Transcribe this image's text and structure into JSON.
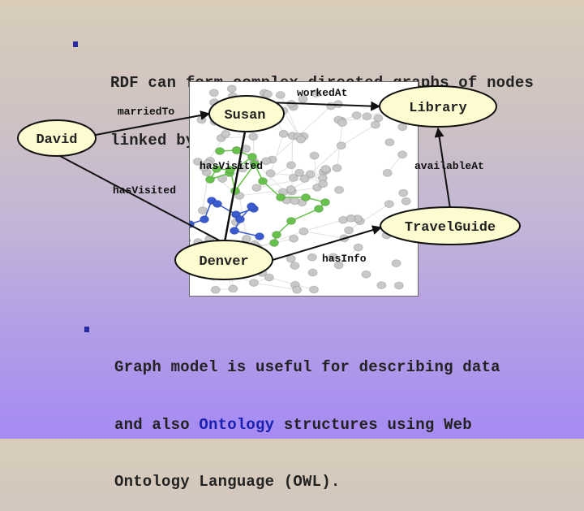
{
  "slide": {
    "bullets": [
      {
        "lines": [
          "RDF can form complex directed graphs of nodes",
          "linked by relationships."
        ]
      },
      {
        "lines_parts": [
          [
            {
              "text": "Graph model is useful for describing data",
              "highlight": false
            }
          ],
          [
            {
              "text": "and also ",
              "highlight": false
            },
            {
              "text": "Ontology",
              "highlight": true
            },
            {
              "text": " structures using Web",
              "highlight": false
            }
          ],
          [
            {
              "text": "Ontology Language (OWL).",
              "highlight": false
            }
          ]
        ]
      }
    ],
    "colors": {
      "bullet": "#2a2aa0",
      "highlight": "#1a20b0",
      "node_fill": "#fdfbd0",
      "gray_node": "#c8c8c8",
      "green_node": "#66c24a",
      "blue_node": "#3a5ad0"
    }
  },
  "diagram": {
    "nodes": {
      "susan": "Susan",
      "library": "Library",
      "david": "David",
      "travelguide": "TravelGuide",
      "denver": "Denver"
    },
    "edges": {
      "workedAt": "workedAt",
      "marriedTo": "marriedTo",
      "hasVisited_susan": "hasVisited",
      "hasVisited_david": "hasVisited",
      "availableAt": "availableAt",
      "hasInfo": "hasInfo"
    }
  }
}
